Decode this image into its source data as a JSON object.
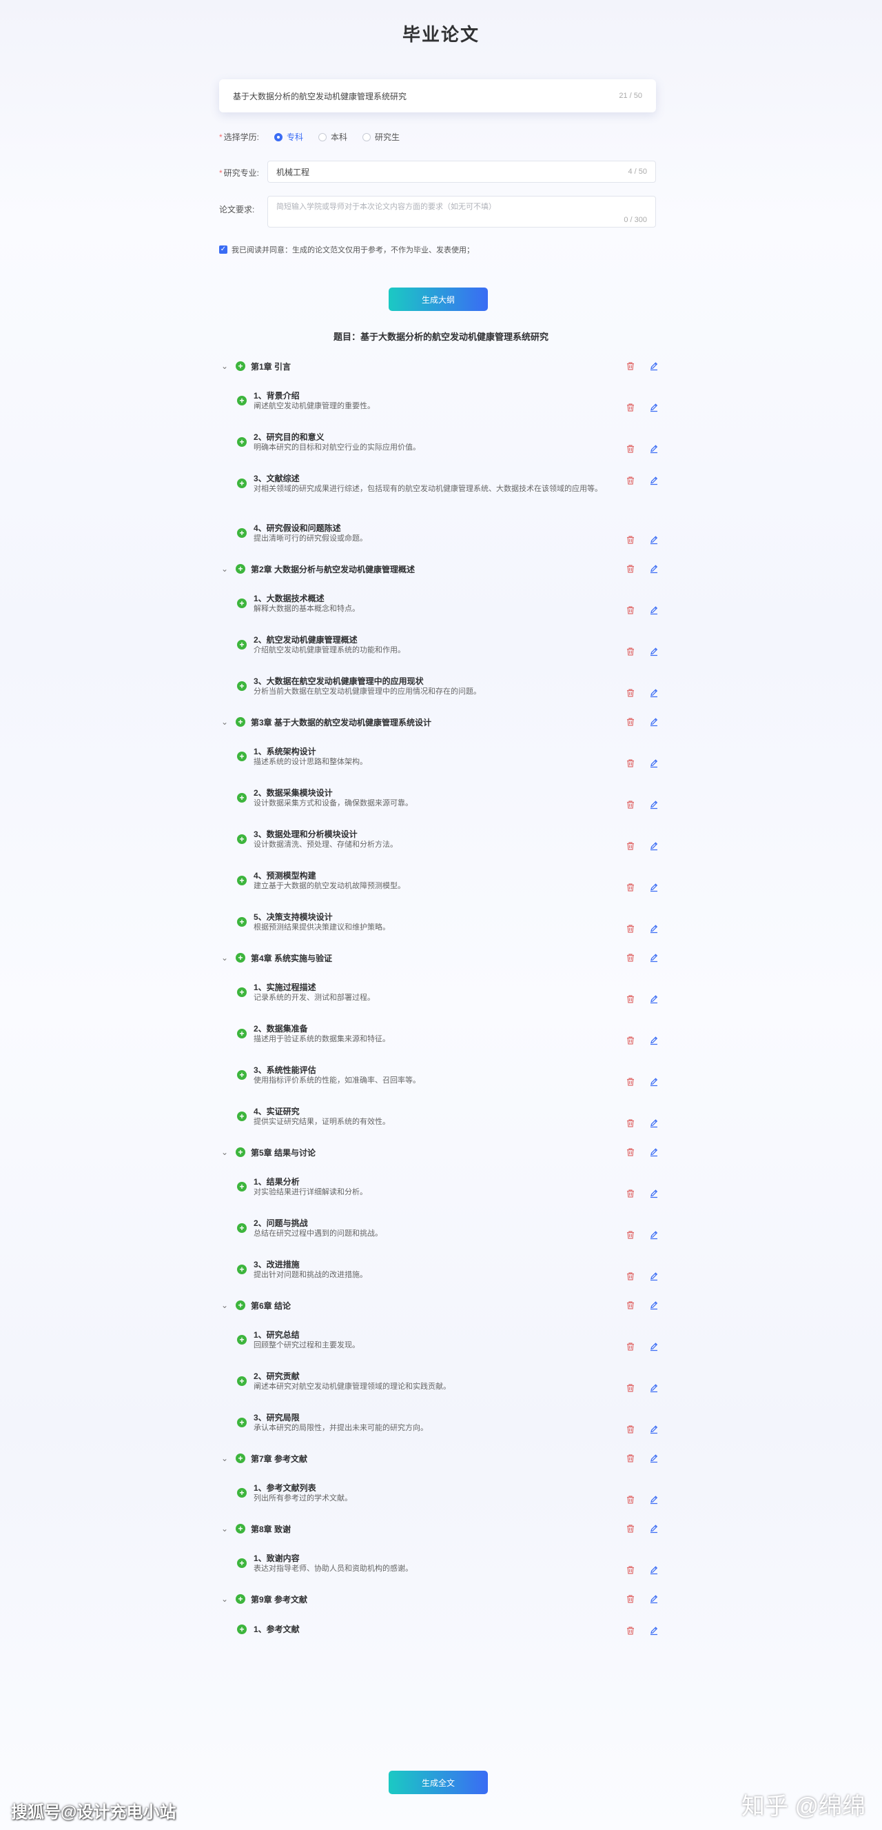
{
  "page": {
    "title": "毕业论文"
  },
  "form": {
    "topic_value": "基于大数据分析的航空发动机健康管理系统研究",
    "topic_counter": "21 / 50",
    "degree_label": "选择学历:",
    "degree_options": [
      {
        "label": "专科",
        "selected": true
      },
      {
        "label": "本科",
        "selected": false
      },
      {
        "label": "研究生",
        "selected": false
      }
    ],
    "major_label": "研究专业:",
    "major_value": "机械工程",
    "major_counter": "4 / 50",
    "req_label": "论文要求:",
    "req_placeholder": "简短输入学院或导师对于本次论文内容方面的要求（如无可不填）",
    "req_counter": "0 / 300",
    "agree_text": "我已阅读并同意：生成的论文范文仅用于参考，不作为毕业、发表使用；",
    "outline_button": "生成大纲"
  },
  "outline": {
    "heading": "题目：基于大数据分析的航空发动机健康管理系统研究",
    "chapters": [
      {
        "title": "第1章 引言",
        "sections": [
          {
            "title": "1、背景介绍",
            "desc": "阐述航空发动机健康管理的重要性。"
          },
          {
            "title": "2、研究目的和意义",
            "desc": "明确本研究的目标和对航空行业的实际应用价值。"
          },
          {
            "title": "3、文献综述",
            "desc": "对相关领域的研究成果进行综述，包括现有的航空发动机健康管理系统、大数据技术在该领域的应用等。"
          },
          {
            "title": "4、研究假设和问题陈述",
            "desc": "提出清晰可行的研究假设或命题。"
          }
        ]
      },
      {
        "title": "第2章 大数据分析与航空发动机健康管理概述",
        "sections": [
          {
            "title": "1、大数据技术概述",
            "desc": "解释大数据的基本概念和特点。"
          },
          {
            "title": "2、航空发动机健康管理概述",
            "desc": "介绍航空发动机健康管理系统的功能和作用。"
          },
          {
            "title": "3、大数据在航空发动机健康管理中的应用现状",
            "desc": "分析当前大数据在航空发动机健康管理中的应用情况和存在的问题。"
          }
        ]
      },
      {
        "title": "第3章 基于大数据的航空发动机健康管理系统设计",
        "sections": [
          {
            "title": "1、系统架构设计",
            "desc": "描述系统的设计思路和整体架构。"
          },
          {
            "title": "2、数据采集模块设计",
            "desc": "设计数据采集方式和设备，确保数据来源可靠。"
          },
          {
            "title": "3、数据处理和分析模块设计",
            "desc": "设计数据清洗、预处理、存储和分析方法。"
          },
          {
            "title": "4、预测模型构建",
            "desc": "建立基于大数据的航空发动机故障预测模型。"
          },
          {
            "title": "5、决策支持模块设计",
            "desc": "根据预测结果提供决策建议和维护策略。"
          }
        ]
      },
      {
        "title": "第4章 系统实施与验证",
        "sections": [
          {
            "title": "1、实施过程描述",
            "desc": "记录系统的开发、测试和部署过程。"
          },
          {
            "title": "2、数据集准备",
            "desc": "描述用于验证系统的数据集来源和特征。"
          },
          {
            "title": "3、系统性能评估",
            "desc": "使用指标评价系统的性能，如准确率、召回率等。"
          },
          {
            "title": "4、实证研究",
            "desc": "提供实证研究结果，证明系统的有效性。"
          }
        ]
      },
      {
        "title": "第5章 结果与讨论",
        "sections": [
          {
            "title": "1、结果分析",
            "desc": "对实验结果进行详细解读和分析。"
          },
          {
            "title": "2、问题与挑战",
            "desc": "总结在研究过程中遇到的问题和挑战。"
          },
          {
            "title": "3、改进措施",
            "desc": "提出针对问题和挑战的改进措施。"
          }
        ]
      },
      {
        "title": "第6章 结论",
        "sections": [
          {
            "title": "1、研究总结",
            "desc": "回顾整个研究过程和主要发现。"
          },
          {
            "title": "2、研究贡献",
            "desc": "阐述本研究对航空发动机健康管理领域的理论和实践贡献。"
          },
          {
            "title": "3、研究局限",
            "desc": "承认本研究的局限性，并提出未来可能的研究方向。"
          }
        ]
      },
      {
        "title": "第7章 参考文献",
        "sections": [
          {
            "title": "1、参考文献列表",
            "desc": "列出所有参考过的学术文献。"
          }
        ]
      },
      {
        "title": "第8章 致谢",
        "sections": [
          {
            "title": "1、致谢内容",
            "desc": "表达对指导老师、协助人员和资助机构的感谢。"
          }
        ]
      },
      {
        "title": "第9章 参考文献",
        "sections": [
          {
            "title": "1、参考文献",
            "desc": ""
          }
        ]
      }
    ],
    "full_button": "生成全文"
  },
  "watermarks": {
    "left": "搜狐号@设计充电小站",
    "right": "知乎 @绵绵"
  },
  "colors": {
    "accent": "#3a6cf4",
    "button_start": "#1bc9c3",
    "plus_green": "#3db53d",
    "trash_red": "#e06c6c",
    "edit_blue": "#3a6cf4"
  }
}
